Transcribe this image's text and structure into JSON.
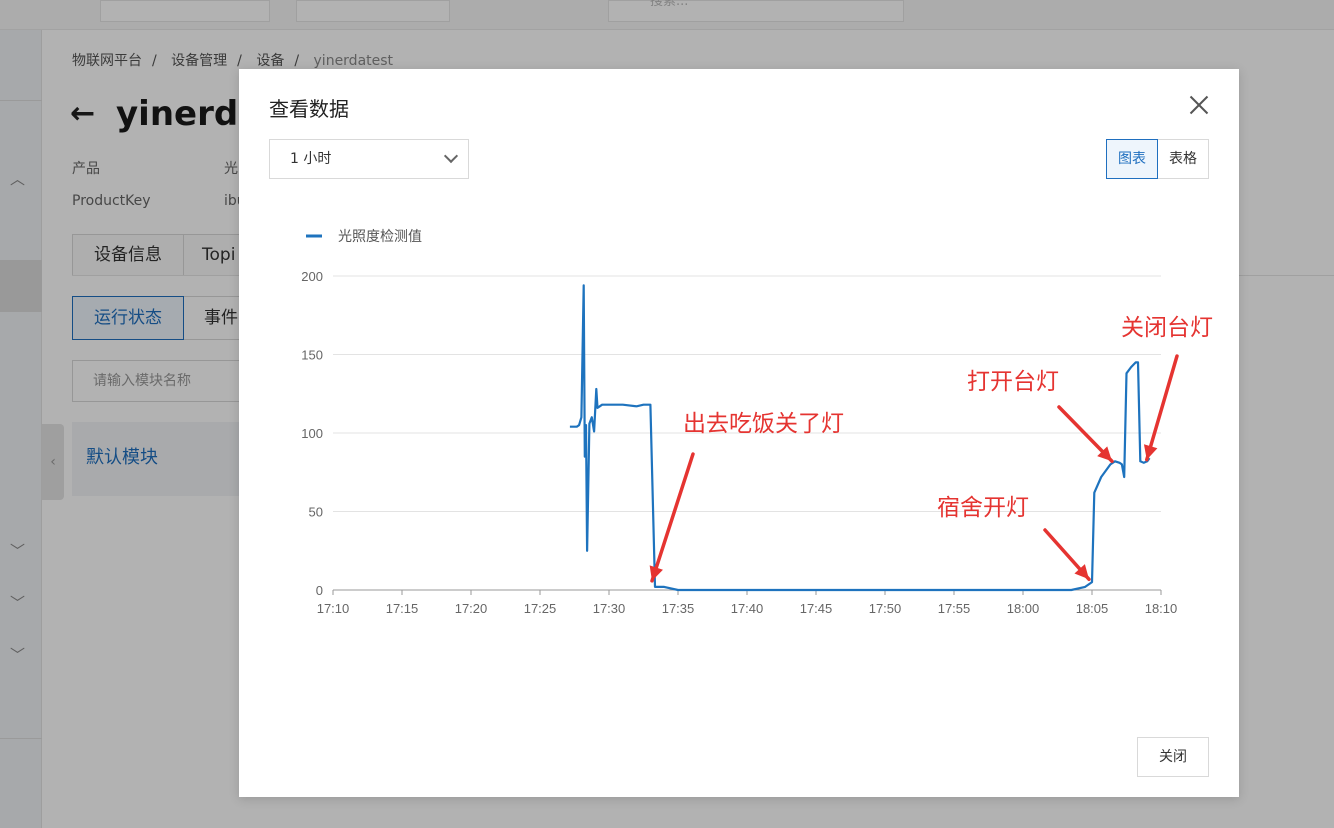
{
  "topbar": {
    "search_placeholder": "搜索..."
  },
  "breadcrumb": [
    "物联网平台",
    "设备管理",
    "设备",
    "yinerdatest"
  ],
  "device": {
    "title": "yinerda",
    "product_label": "产品",
    "product_value": "光",
    "productkey_label": "ProductKey",
    "productkey_value": "ibu"
  },
  "tabs": {
    "device_info": "设备信息",
    "topic": "Topi"
  },
  "subtabs": {
    "running_status": "运行状态",
    "events": "事件"
  },
  "module_search": {
    "placeholder": "请输入模块名称"
  },
  "module_card": {
    "label": "默认模块"
  },
  "modal": {
    "title": "查看数据",
    "range_value": "1 小时",
    "view_chart": "图表",
    "view_table": "表格",
    "close_button": "关闭"
  },
  "chart_data": {
    "type": "line",
    "title": "",
    "xlabel": "",
    "ylabel": "",
    "xlim": [
      "17:10",
      "18:10"
    ],
    "ylim": [
      0,
      200
    ],
    "yticks": [
      0,
      50,
      100,
      150,
      200
    ],
    "xticks": [
      "17:10",
      "17:15",
      "17:20",
      "17:25",
      "17:30",
      "17:35",
      "17:40",
      "17:45",
      "17:50",
      "17:55",
      "18:00",
      "18:05",
      "18:10"
    ],
    "grid": true,
    "legend_position": "top-left",
    "series": [
      {
        "name": "光照度检测值",
        "color": "#1e73be",
        "points": [
          [
            "17:27:10",
            104
          ],
          [
            "17:27:40",
            104
          ],
          [
            "17:27:50",
            105
          ],
          [
            "17:28:00",
            110
          ],
          [
            "17:28:10",
            194
          ],
          [
            "17:28:15",
            85
          ],
          [
            "17:28:20",
            105
          ],
          [
            "17:28:25",
            25
          ],
          [
            "17:28:35",
            106
          ],
          [
            "17:28:45",
            110
          ],
          [
            "17:28:55",
            101
          ],
          [
            "17:29:05",
            128
          ],
          [
            "17:29:10",
            116
          ],
          [
            "17:29:20",
            117
          ],
          [
            "17:29:30",
            118
          ],
          [
            "17:30:00",
            118
          ],
          [
            "17:31:00",
            118
          ],
          [
            "17:32:00",
            117
          ],
          [
            "17:32:30",
            118
          ],
          [
            "17:33:00",
            118
          ],
          [
            "17:33:20",
            2
          ],
          [
            "17:34:00",
            2
          ],
          [
            "17:35:00",
            0
          ],
          [
            "17:45:00",
            0
          ],
          [
            "17:55:00",
            0
          ],
          [
            "18:03:30",
            0
          ],
          [
            "18:04:30",
            2
          ],
          [
            "18:05:00",
            5
          ],
          [
            "18:05:10",
            62
          ],
          [
            "18:05:40",
            72
          ],
          [
            "18:06:20",
            80
          ],
          [
            "18:06:40",
            82
          ],
          [
            "18:07:00",
            81
          ],
          [
            "18:07:10",
            80
          ],
          [
            "18:07:20",
            72
          ],
          [
            "18:07:30",
            138
          ],
          [
            "18:07:50",
            142
          ],
          [
            "18:08:10",
            145
          ],
          [
            "18:08:20",
            145
          ],
          [
            "18:08:30",
            82
          ],
          [
            "18:08:45",
            81
          ],
          [
            "18:09:00",
            82
          ],
          [
            "18:09:10",
            84
          ]
        ]
      }
    ],
    "annotations": [
      {
        "text": "出去吃饭关了灯",
        "target": [
          "17:33:20",
          2
        ]
      },
      {
        "text": "宿舍开灯",
        "target": [
          "18:05:00",
          3
        ]
      },
      {
        "text": "打开台灯",
        "target": [
          "18:06:40",
          82
        ]
      },
      {
        "text": "关闭台灯",
        "target": [
          "18:08:45",
          83
        ]
      }
    ]
  }
}
